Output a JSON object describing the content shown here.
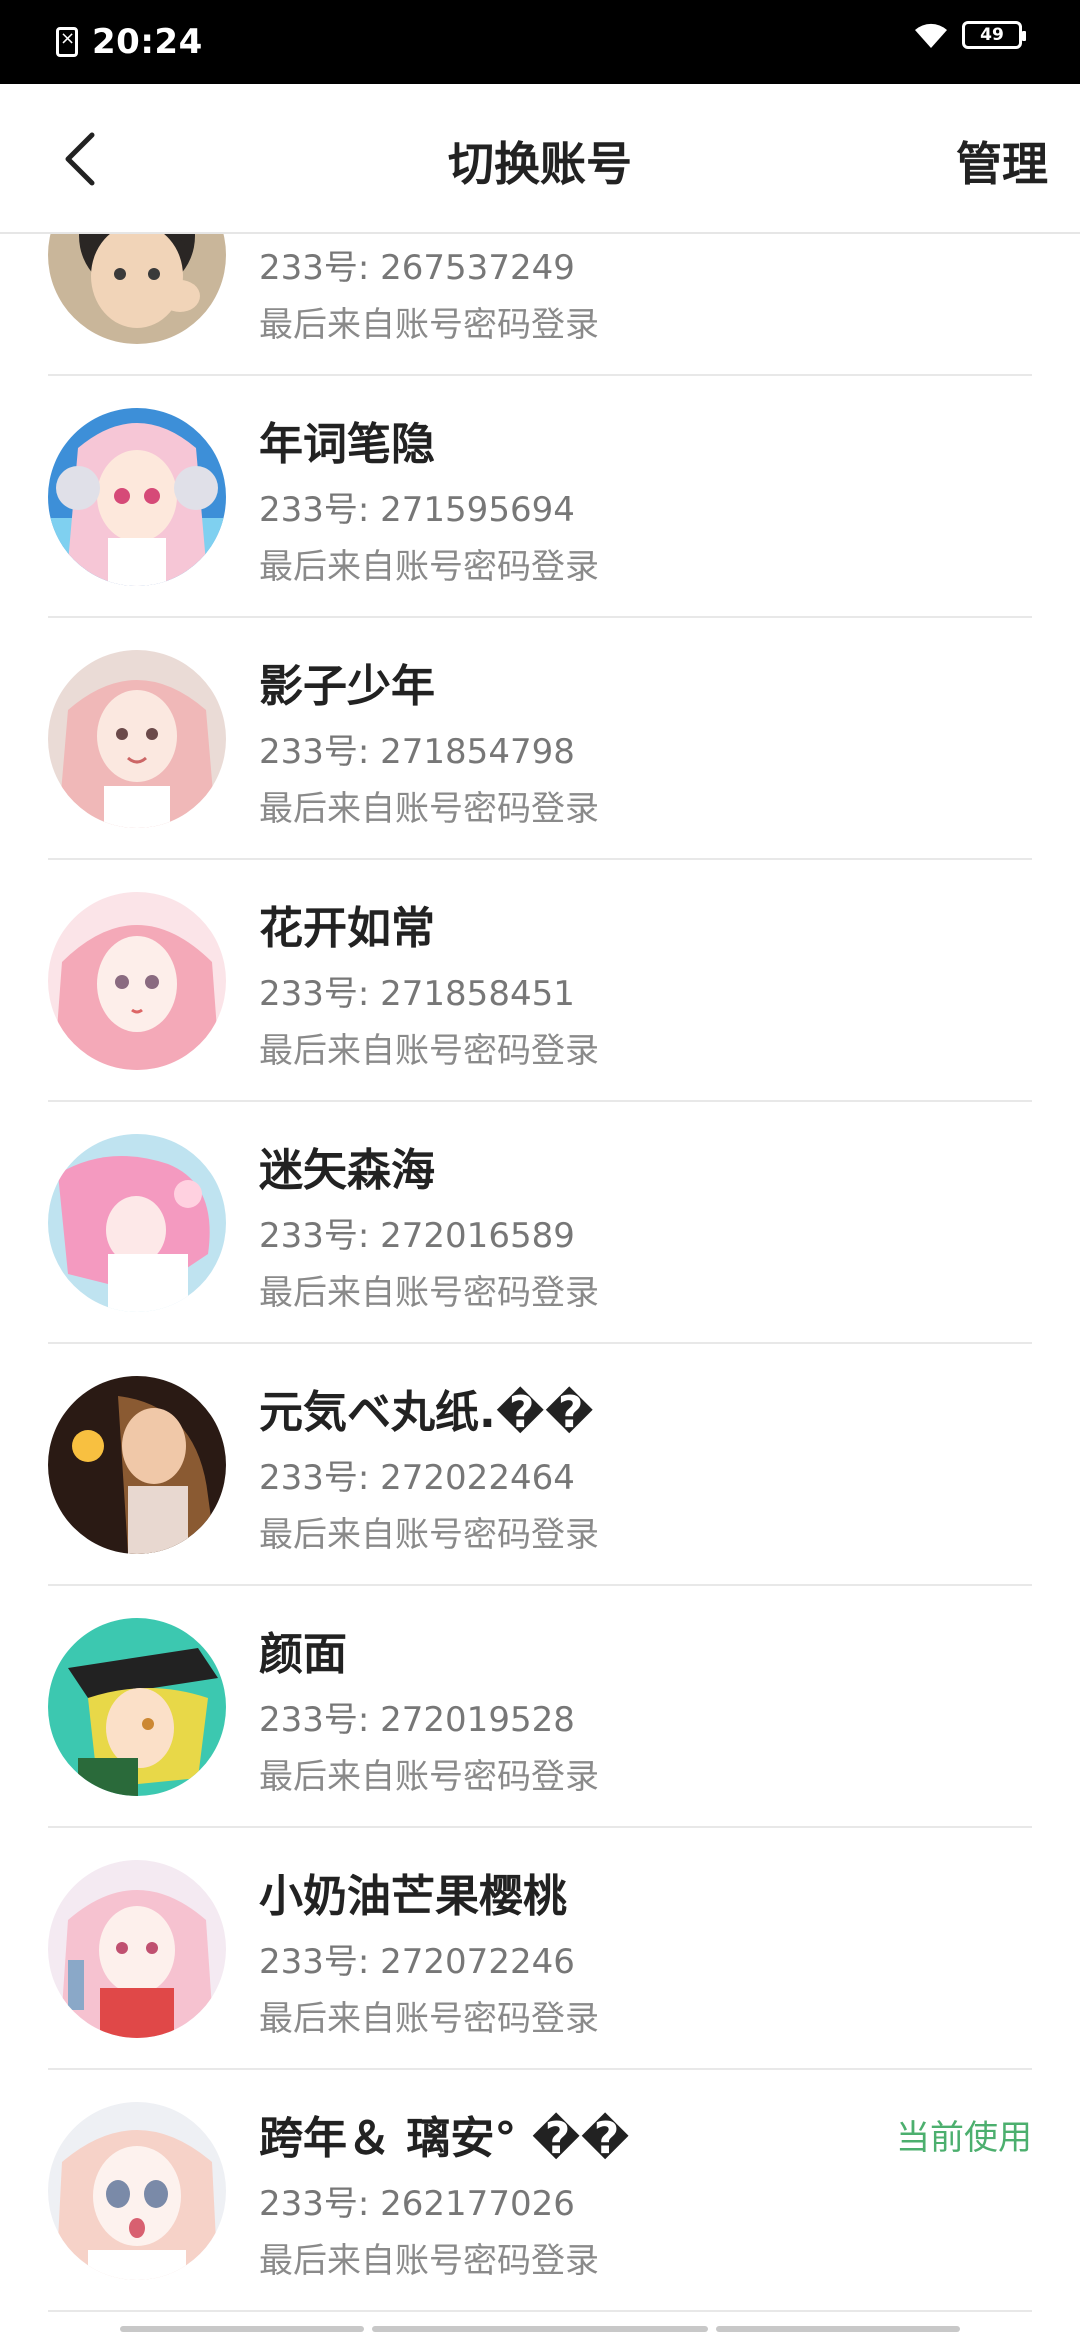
{
  "status_bar": {
    "time": "20:24",
    "battery": "49",
    "icons": [
      "sim-card-x-icon",
      "wifi-icon",
      "battery-icon"
    ]
  },
  "header": {
    "title": "切换账号",
    "manage_label": "管理",
    "back_icon": "chevron-left-icon"
  },
  "accounts": [
    {
      "name": "",
      "uid": "233号: 267537249",
      "login": "最后来自账号密码登录",
      "current": ""
    },
    {
      "name": "年词笔隐",
      "uid": "233号: 271595694",
      "login": "最后来自账号密码登录",
      "current": ""
    },
    {
      "name": "影子少年",
      "uid": "233号: 271854798",
      "login": "最后来自账号密码登录",
      "current": ""
    },
    {
      "name": "花开如常",
      "uid": "233号: 271858451",
      "login": "最后来自账号密码登录",
      "current": ""
    },
    {
      "name": "迷矢森海",
      "uid": "233号: 272016589",
      "login": "最后来自账号密码登录",
      "current": ""
    },
    {
      "name": "元気ベ丸纸.��",
      "uid": "233号: 272022464",
      "login": "最后来自账号密码登录",
      "current": ""
    },
    {
      "name": "颜面",
      "uid": "233号: 272019528",
      "login": "最后来自账号密码登录",
      "current": ""
    },
    {
      "name": "小奶油芒果樱桃",
      "uid": "233号: 272072246",
      "login": "最后来自账号密码登录",
      "current": ""
    },
    {
      "name": "跨年＆ 璃安° ��",
      "uid": "233号: 262177026",
      "login": "最后来自账号密码登录",
      "current": "当前使用"
    }
  ],
  "colors": {
    "accent_green": "#4caf6e",
    "text_primary": "#222222",
    "text_secondary": "#8a8a8a",
    "divider": "#e8e8e8"
  }
}
